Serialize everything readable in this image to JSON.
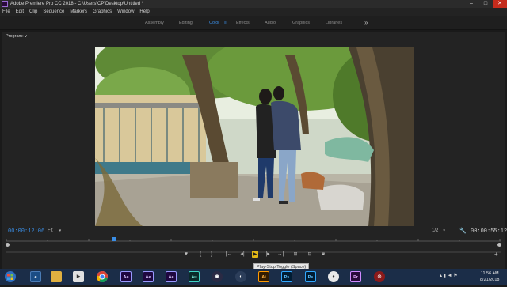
{
  "window": {
    "title": "Adobe Premiere Pro CC 2018 - C:\\Users\\CP\\Desktop\\Untitled *"
  },
  "menu": [
    "File",
    "Edit",
    "Clip",
    "Sequence",
    "Markers",
    "Graphics",
    "Window",
    "Help"
  ],
  "workspaces": {
    "tabs": [
      "Assembly",
      "Editing",
      "Color",
      "Effects",
      "Audio",
      "Graphics",
      "Libraries"
    ],
    "active": "Color",
    "menu_glyph": "≡",
    "more_glyph": "»"
  },
  "program_monitor": {
    "tab_label": "Program: v",
    "current_timecode": "00:00:12:06",
    "zoom_value": "Fit",
    "resolution_value": "1/2",
    "duration_timecode": "00:00:55:12",
    "playhead_position_percent": 22
  },
  "transport": {
    "tooltip": "Play-Stop Toggle (Space)"
  },
  "taskbar": {
    "apps": [
      {
        "name": "chrome-icon",
        "label": ""
      },
      {
        "name": "after-effects-icon",
        "label": "Ae"
      },
      {
        "name": "after-effects-icon-2",
        "label": "Ae"
      },
      {
        "name": "after-effects-icon-3",
        "label": "Ae"
      },
      {
        "name": "audition-icon",
        "label": "Au"
      },
      {
        "name": "illustrator-icon",
        "label": "Ai"
      },
      {
        "name": "photoshop-icon",
        "label": "Ps"
      },
      {
        "name": "photoshop-icon-2",
        "label": "Ps"
      },
      {
        "name": "premiere-icon",
        "label": "Pr"
      }
    ],
    "time": "11:56 AM",
    "date": "8/21/2018"
  },
  "colors": {
    "accent": "#3a8ee6",
    "play_button": "#e2b816",
    "taskbar": "#1b2d48"
  }
}
